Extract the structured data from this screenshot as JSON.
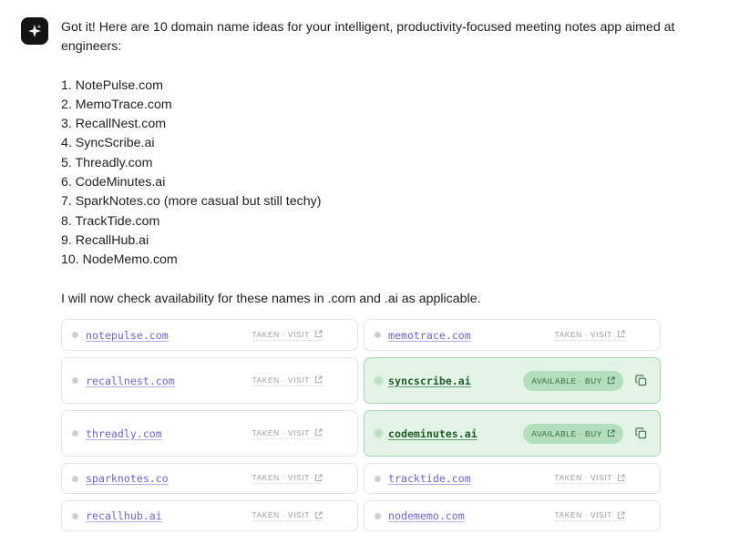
{
  "message": {
    "intro": "Got it! Here are 10 domain name ideas for your intelligent, productivity-focused meeting notes app aimed at engineers:",
    "ideas": [
      "1. NotePulse.com",
      "2. MemoTrace.com",
      "3. RecallNest.com",
      "4. SyncScribe.ai",
      "5. Threadly.com",
      "6. CodeMinutes.ai",
      "7. SparkNotes.co (more casual but still techy)",
      "8. TrackTide.com",
      "9. RecallHub.ai",
      "10. NodeMemo.com"
    ],
    "closing": "I will now check availability for these names in .com and .ai as applicable."
  },
  "domains": [
    {
      "name": "notepulse.com",
      "status": "TAKEN · VISIT",
      "available": false
    },
    {
      "name": "memotrace.com",
      "status": "TAKEN · VISIT",
      "available": false
    },
    {
      "name": "recallnest.com",
      "status": "TAKEN · VISIT",
      "available": false
    },
    {
      "name": "syncscribe.ai",
      "status": "AVAILABLE · BUY",
      "available": true
    },
    {
      "name": "threadly.com",
      "status": "TAKEN · VISIT",
      "available": false
    },
    {
      "name": "codeminutes.ai",
      "status": "AVAILABLE · BUY",
      "available": true
    },
    {
      "name": "sparknotes.co",
      "status": "TAKEN · VISIT",
      "available": false
    },
    {
      "name": "tracktide.com",
      "status": "TAKEN · VISIT",
      "available": false
    },
    {
      "name": "recallhub.ai",
      "status": "TAKEN · VISIT",
      "available": false
    },
    {
      "name": "nodememo.com",
      "status": "TAKEN · VISIT",
      "available": false
    }
  ],
  "icons": {
    "avatar": "sparkle-icon",
    "external": "external-link-icon",
    "copy": "copy-icon"
  },
  "colors": {
    "link": "#6b63d9",
    "available_bg": "#e3f4e6",
    "available_border": "#a7d7b0",
    "available_pill": "#b4dfbd",
    "available_text": "#1f5c2c"
  }
}
